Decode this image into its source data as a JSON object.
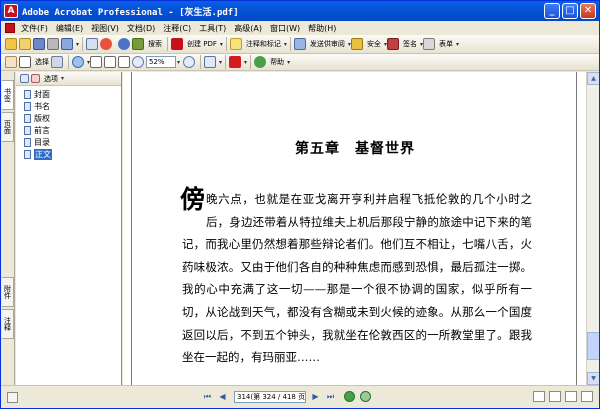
{
  "window": {
    "title": "Adobe Acrobat Professional - [灰生活.pdf]",
    "app_icon_glyph": "A",
    "controls": {
      "minimize": "_",
      "maximize": "□",
      "close": "✕"
    }
  },
  "menubar": {
    "items": [
      "文件(F)",
      "编辑(E)",
      "视图(V)",
      "文档(D)",
      "注释(C)",
      "工具(T)",
      "高级(A)",
      "窗口(W)",
      "帮助(H)"
    ]
  },
  "toolbar1": {
    "print_label": "",
    "browser_label": "",
    "search_label": "搜索",
    "create_pdf_label": "创建 PDF",
    "comment_label": "注释和标记",
    "send_review_label": "发送供审阅",
    "secure_label": "安全",
    "sign_label": "签名",
    "forms_label": "表单",
    "dropdown_glyph": "▾"
  },
  "toolbar2": {
    "select_label": "选择",
    "zoom_value": "52%",
    "help_label": "帮助"
  },
  "navigation_tabs": {
    "bookmarks": "书签",
    "pages": "页面",
    "attachments": "附件",
    "comments": "注释"
  },
  "bookmarks": {
    "options_label": "选项",
    "items": [
      {
        "label": "封面"
      },
      {
        "label": "书名"
      },
      {
        "label": "版权"
      },
      {
        "label": "前言"
      },
      {
        "label": "目录"
      },
      {
        "label": "正文"
      }
    ],
    "selected_label": "正文"
  },
  "document": {
    "chapter_title": "第五章　基督世界",
    "dropcap": "傍",
    "body": "晚六点，也就是在亚戈离开亨利并启程飞抵伦敦的几个小时之后，身边还带着从特拉维夫上机后那段宁静的旅途中记下来的笔记，而我心里仍然想着那些辩论者们。他们互不相让，七嘴八舌，火药味极浓。又由于他们各自的种种焦虑而感到恐惧，最后孤注一掷。我的心中充满了这一切——那是一个很不协调的国家，似乎所有一切，从论战到天气，都没有含糊或未到火候的迹象。从那么一个国度返回以后，不到五个钟头，我就坐在伦敦西区的一所教堂里了。跟我坐在一起的，有玛丽亚……"
  },
  "statusbar": {
    "page_indicator": "314(第 324 / 418 页)",
    "first_glyph": "⏮",
    "prev_glyph": "◀",
    "next_glyph": "▶",
    "last_glyph": "⏭"
  },
  "scrollbar": {
    "up_glyph": "▲",
    "down_glyph": "▼"
  },
  "colors": {
    "titlebar": "#0452d6",
    "selection": "#316ac5",
    "pdf_red": "#c8101b"
  }
}
